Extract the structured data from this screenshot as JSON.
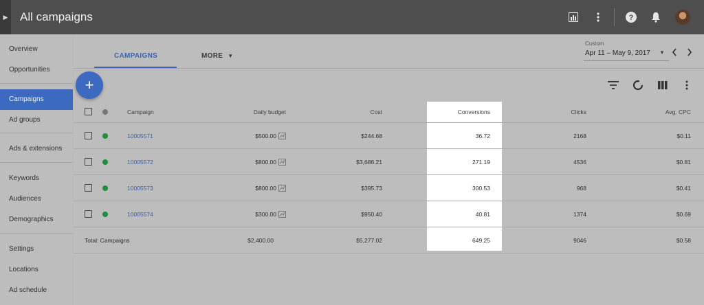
{
  "header": {
    "title": "All campaigns",
    "icons": [
      "bar-chart-icon",
      "more-vert-icon",
      "help-icon",
      "bell-icon",
      "avatar"
    ]
  },
  "sidebar": {
    "items": [
      {
        "label": "Overview"
      },
      {
        "label": "Opportunities"
      },
      {
        "label": "Campaigns",
        "active": true
      },
      {
        "label": "Ad groups"
      },
      {
        "label": "Ads & extensions"
      },
      {
        "label": "Keywords"
      },
      {
        "label": "Audiences"
      },
      {
        "label": "Demographics"
      },
      {
        "label": "Settings"
      },
      {
        "label": "Locations"
      },
      {
        "label": "Ad schedule"
      }
    ]
  },
  "tabs": {
    "campaigns": "CAMPAIGNS",
    "more": "MORE"
  },
  "date": {
    "label": "Custom",
    "range": "Apr 11 – May 9, 2017"
  },
  "fab": {
    "label": "+"
  },
  "table": {
    "headers": {
      "campaign": "Campaign",
      "budget": "Daily budget",
      "cost": "Cost",
      "conversions": "Conversions",
      "clicks": "Clicks",
      "cpc": "Avg. CPC"
    },
    "rows": [
      {
        "campaign": "10005571",
        "budget": "$500.00",
        "cost": "$244.68",
        "conversions": "36.72",
        "clicks": "2168",
        "cpc": "$0.11"
      },
      {
        "campaign": "10005572",
        "budget": "$800.00",
        "cost": "$3,686.21",
        "conversions": "271.19",
        "clicks": "4536",
        "cpc": "$0.81"
      },
      {
        "campaign": "10005573",
        "budget": "$800.00",
        "cost": "$395.73",
        "conversions": "300.53",
        "clicks": "968",
        "cpc": "$0.41"
      },
      {
        "campaign": "10005574",
        "budget": "$300.00",
        "cost": "$950.40",
        "conversions": "40.81",
        "clicks": "1374",
        "cpc": "$0.69"
      }
    ],
    "totals": {
      "label": "Total: Campaigns",
      "budget": "$2,400.00",
      "cost": "$5,277.02",
      "conversions": "649.25",
      "clicks": "9046",
      "cpc": "$0.58"
    }
  },
  "colors": {
    "accent": "#3d6ac1",
    "status_enabled": "#1e8e3e",
    "topbar": "#4e4e4e"
  }
}
